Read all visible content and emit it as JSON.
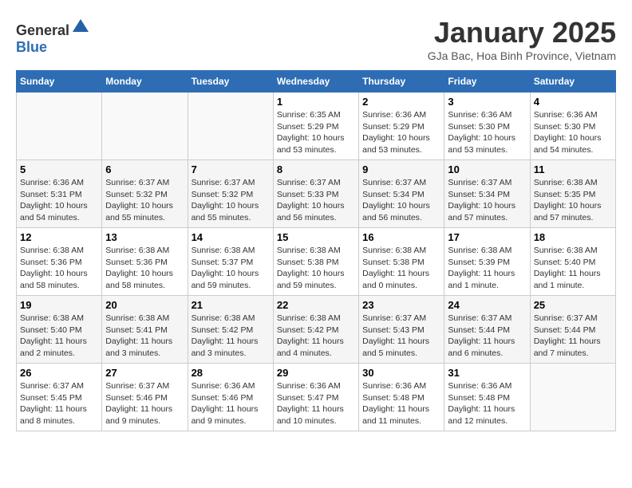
{
  "header": {
    "logo_general": "General",
    "logo_blue": "Blue",
    "title": "January 2025",
    "subtitle": "GJa Bac, Hoa Binh Province, Vietnam"
  },
  "weekdays": [
    "Sunday",
    "Monday",
    "Tuesday",
    "Wednesday",
    "Thursday",
    "Friday",
    "Saturday"
  ],
  "weeks": [
    [
      {
        "day": "",
        "info": ""
      },
      {
        "day": "",
        "info": ""
      },
      {
        "day": "",
        "info": ""
      },
      {
        "day": "1",
        "info": "Sunrise: 6:35 AM\nSunset: 5:29 PM\nDaylight: 10 hours\nand 53 minutes."
      },
      {
        "day": "2",
        "info": "Sunrise: 6:36 AM\nSunset: 5:29 PM\nDaylight: 10 hours\nand 53 minutes."
      },
      {
        "day": "3",
        "info": "Sunrise: 6:36 AM\nSunset: 5:30 PM\nDaylight: 10 hours\nand 53 minutes."
      },
      {
        "day": "4",
        "info": "Sunrise: 6:36 AM\nSunset: 5:30 PM\nDaylight: 10 hours\nand 54 minutes."
      }
    ],
    [
      {
        "day": "5",
        "info": "Sunrise: 6:36 AM\nSunset: 5:31 PM\nDaylight: 10 hours\nand 54 minutes."
      },
      {
        "day": "6",
        "info": "Sunrise: 6:37 AM\nSunset: 5:32 PM\nDaylight: 10 hours\nand 55 minutes."
      },
      {
        "day": "7",
        "info": "Sunrise: 6:37 AM\nSunset: 5:32 PM\nDaylight: 10 hours\nand 55 minutes."
      },
      {
        "day": "8",
        "info": "Sunrise: 6:37 AM\nSunset: 5:33 PM\nDaylight: 10 hours\nand 56 minutes."
      },
      {
        "day": "9",
        "info": "Sunrise: 6:37 AM\nSunset: 5:34 PM\nDaylight: 10 hours\nand 56 minutes."
      },
      {
        "day": "10",
        "info": "Sunrise: 6:37 AM\nSunset: 5:34 PM\nDaylight: 10 hours\nand 57 minutes."
      },
      {
        "day": "11",
        "info": "Sunrise: 6:38 AM\nSunset: 5:35 PM\nDaylight: 10 hours\nand 57 minutes."
      }
    ],
    [
      {
        "day": "12",
        "info": "Sunrise: 6:38 AM\nSunset: 5:36 PM\nDaylight: 10 hours\nand 58 minutes."
      },
      {
        "day": "13",
        "info": "Sunrise: 6:38 AM\nSunset: 5:36 PM\nDaylight: 10 hours\nand 58 minutes."
      },
      {
        "day": "14",
        "info": "Sunrise: 6:38 AM\nSunset: 5:37 PM\nDaylight: 10 hours\nand 59 minutes."
      },
      {
        "day": "15",
        "info": "Sunrise: 6:38 AM\nSunset: 5:38 PM\nDaylight: 10 hours\nand 59 minutes."
      },
      {
        "day": "16",
        "info": "Sunrise: 6:38 AM\nSunset: 5:38 PM\nDaylight: 11 hours\nand 0 minutes."
      },
      {
        "day": "17",
        "info": "Sunrise: 6:38 AM\nSunset: 5:39 PM\nDaylight: 11 hours\nand 1 minute."
      },
      {
        "day": "18",
        "info": "Sunrise: 6:38 AM\nSunset: 5:40 PM\nDaylight: 11 hours\nand 1 minute."
      }
    ],
    [
      {
        "day": "19",
        "info": "Sunrise: 6:38 AM\nSunset: 5:40 PM\nDaylight: 11 hours\nand 2 minutes."
      },
      {
        "day": "20",
        "info": "Sunrise: 6:38 AM\nSunset: 5:41 PM\nDaylight: 11 hours\nand 3 minutes."
      },
      {
        "day": "21",
        "info": "Sunrise: 6:38 AM\nSunset: 5:42 PM\nDaylight: 11 hours\nand 3 minutes."
      },
      {
        "day": "22",
        "info": "Sunrise: 6:38 AM\nSunset: 5:42 PM\nDaylight: 11 hours\nand 4 minutes."
      },
      {
        "day": "23",
        "info": "Sunrise: 6:37 AM\nSunset: 5:43 PM\nDaylight: 11 hours\nand 5 minutes."
      },
      {
        "day": "24",
        "info": "Sunrise: 6:37 AM\nSunset: 5:44 PM\nDaylight: 11 hours\nand 6 minutes."
      },
      {
        "day": "25",
        "info": "Sunrise: 6:37 AM\nSunset: 5:44 PM\nDaylight: 11 hours\nand 7 minutes."
      }
    ],
    [
      {
        "day": "26",
        "info": "Sunrise: 6:37 AM\nSunset: 5:45 PM\nDaylight: 11 hours\nand 8 minutes."
      },
      {
        "day": "27",
        "info": "Sunrise: 6:37 AM\nSunset: 5:46 PM\nDaylight: 11 hours\nand 9 minutes."
      },
      {
        "day": "28",
        "info": "Sunrise: 6:36 AM\nSunset: 5:46 PM\nDaylight: 11 hours\nand 9 minutes."
      },
      {
        "day": "29",
        "info": "Sunrise: 6:36 AM\nSunset: 5:47 PM\nDaylight: 11 hours\nand 10 minutes."
      },
      {
        "day": "30",
        "info": "Sunrise: 6:36 AM\nSunset: 5:48 PM\nDaylight: 11 hours\nand 11 minutes."
      },
      {
        "day": "31",
        "info": "Sunrise: 6:36 AM\nSunset: 5:48 PM\nDaylight: 11 hours\nand 12 minutes."
      },
      {
        "day": "",
        "info": ""
      }
    ]
  ]
}
